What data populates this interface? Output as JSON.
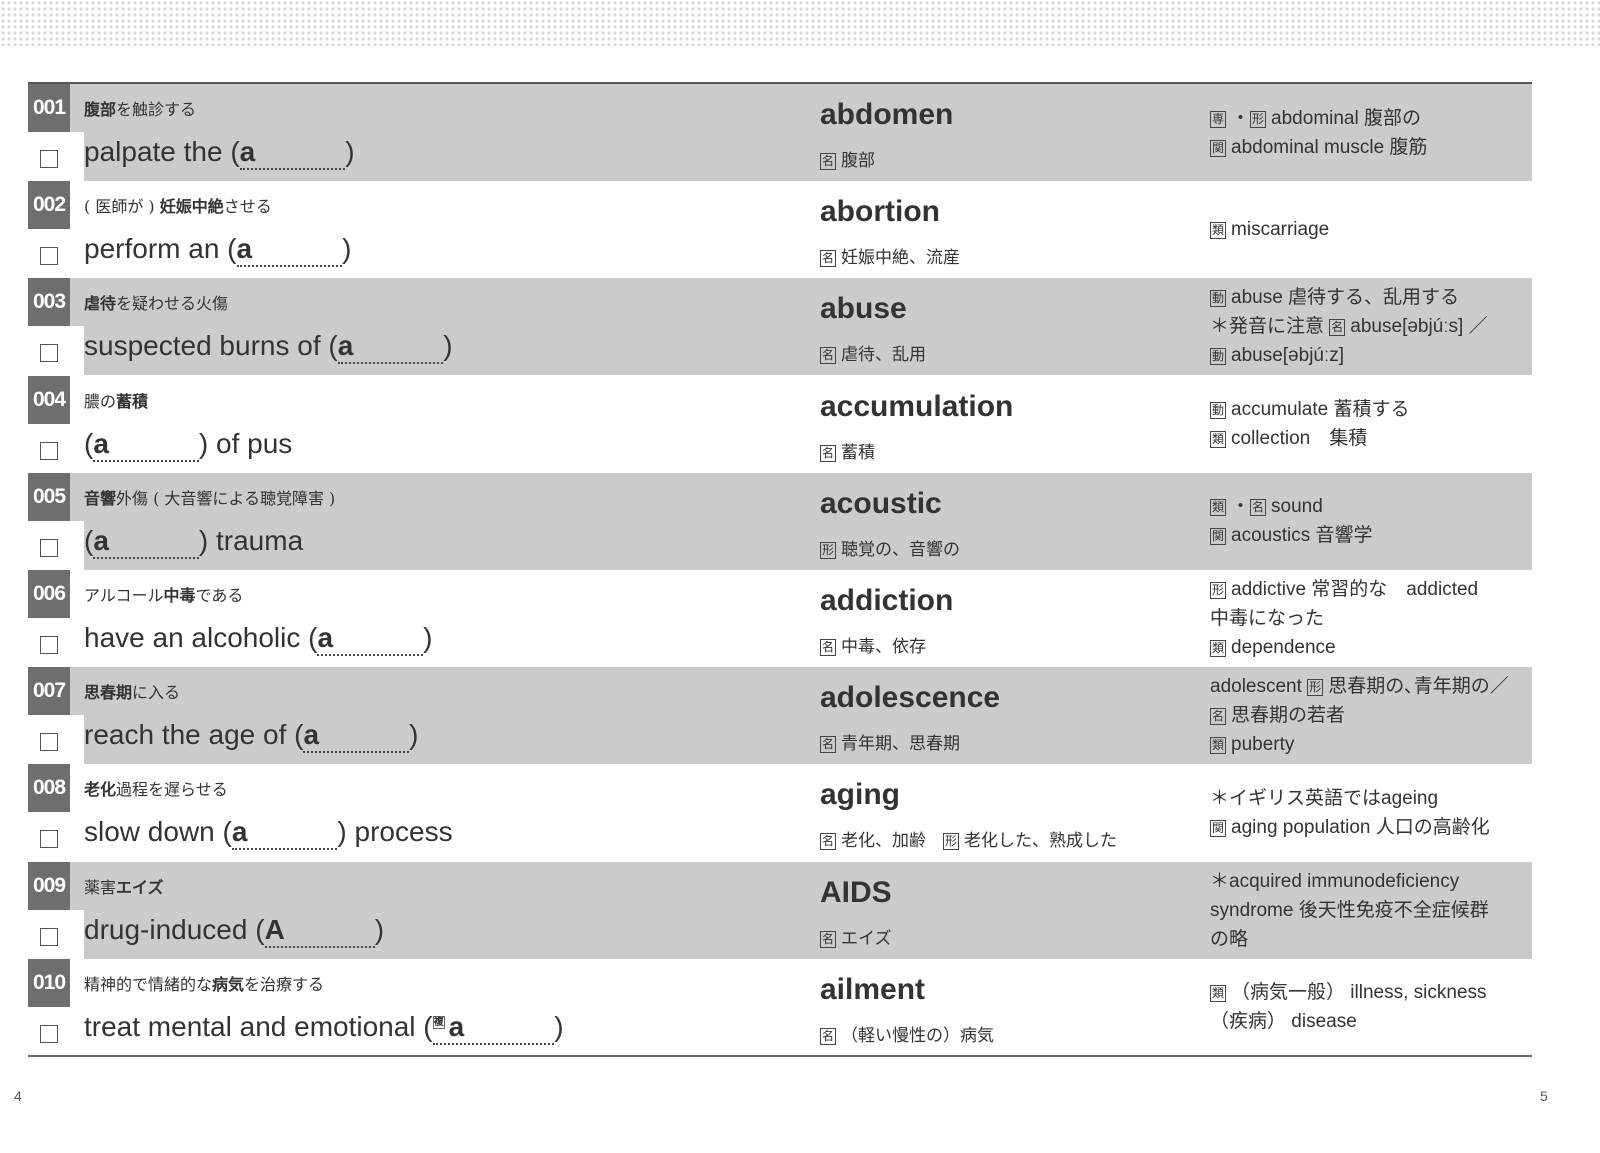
{
  "page_numbers": {
    "left": "4",
    "right": "5"
  },
  "colors": {
    "shade": "#c9cbcd",
    "number_box": "#6e6e6e"
  },
  "left_items": [
    {
      "num": "001",
      "jp": [
        {
          "t": "腹部",
          "b": true
        },
        {
          "t": "を触診する"
        }
      ],
      "before": "palpate the (",
      "hint": "a",
      "after": ")"
    },
    {
      "num": "002",
      "jp": [
        {
          "t": "( 医師が ) "
        },
        {
          "t": "妊娠中絶",
          "b": true
        },
        {
          "t": "させる"
        }
      ],
      "before": "perform an (",
      "hint": "a",
      "after": ")"
    },
    {
      "num": "003",
      "jp": [
        {
          "t": "虐待",
          "b": true
        },
        {
          "t": "を疑わせる火傷"
        }
      ],
      "before": "suspected burns of (",
      "hint": "a",
      "after": ")"
    },
    {
      "num": "004",
      "jp": [
        {
          "t": "膿の"
        },
        {
          "t": "蓄積",
          "b": true
        }
      ],
      "before": "(",
      "hint": "a",
      "after": ") of pus"
    },
    {
      "num": "005",
      "jp": [
        {
          "t": "音響",
          "b": true
        },
        {
          "t": "外傷 ( 大音響による聴覚障害 )"
        }
      ],
      "before": "(",
      "hint": "a",
      "after": ") trauma"
    },
    {
      "num": "006",
      "jp": [
        {
          "t": "アルコール"
        },
        {
          "t": "中毒",
          "b": true
        },
        {
          "t": "である"
        }
      ],
      "before": "have an alcoholic (",
      "hint": "a",
      "after": ")"
    },
    {
      "num": "007",
      "jp": [
        {
          "t": "思春期",
          "b": true
        },
        {
          "t": "に入る"
        }
      ],
      "before": "reach the age of (",
      "hint": "a",
      "after": ")"
    },
    {
      "num": "008",
      "jp": [
        {
          "t": "老化",
          "b": true
        },
        {
          "t": "過程を遅らせる"
        }
      ],
      "before": "slow down (",
      "hint": "a",
      "after": ") process"
    },
    {
      "num": "009",
      "jp": [
        {
          "t": "薬害"
        },
        {
          "t": "エイズ",
          "b": true
        }
      ],
      "before": "drug-induced (",
      "hint": "A",
      "after": ")"
    },
    {
      "num": "010",
      "jp": [
        {
          "t": "精神的で情緒的な"
        },
        {
          "t": "病気",
          "b": true
        },
        {
          "t": "を治療する"
        }
      ],
      "before": "treat mental and emotional (",
      "mark": "複",
      "hint": "a",
      "after": ")"
    }
  ],
  "right_items": [
    {
      "word": "abdomen",
      "pos": "名",
      "meaning": "腹部",
      "notes": [
        [
          {
            "box": "専"
          },
          {
            "t": "・"
          },
          {
            "box": "形"
          },
          {
            "t": "abdominal 腹部の"
          }
        ],
        [
          {
            "box": "関"
          },
          {
            "t": "abdominal muscle 腹筋"
          }
        ]
      ]
    },
    {
      "word": "abortion",
      "pos": "名",
      "meaning": "妊娠中絶、流産",
      "notes": [
        [
          {
            "box": "類"
          },
          {
            "t": "miscarriage"
          }
        ]
      ]
    },
    {
      "word": "abuse",
      "pos": "名",
      "meaning": "虐待、乱用",
      "notes": [
        [
          {
            "box": "動"
          },
          {
            "t": "abuse 虐待する、乱用する"
          }
        ],
        [
          {
            "t": "＊発音に注意 "
          },
          {
            "box": "名"
          },
          {
            "t": "abuse[əbjúːs] ／"
          }
        ],
        [
          {
            "box": "動"
          },
          {
            "t": "abuse[əbjúːz]"
          }
        ]
      ]
    },
    {
      "word": "accumulation",
      "pos": "名",
      "meaning": "蓄積",
      "notes": [
        [
          {
            "box": "動"
          },
          {
            "t": "accumulate 蓄積する"
          }
        ],
        [
          {
            "box": "類"
          },
          {
            "t": "collection　集積"
          }
        ]
      ]
    },
    {
      "word": "acoustic",
      "pos": "形",
      "meaning": "聴覚の、音響の",
      "notes": [
        [
          {
            "box": "類"
          },
          {
            "t": "・"
          },
          {
            "box": "名"
          },
          {
            "t": "sound"
          }
        ],
        [
          {
            "box": "関"
          },
          {
            "t": "acoustics 音響学"
          }
        ]
      ]
    },
    {
      "word": "addiction",
      "pos": "名",
      "meaning": "中毒、依存",
      "notes": [
        [
          {
            "box": "形"
          },
          {
            "t": "addictive 常習的な　addicted"
          }
        ],
        [
          {
            "t": "中毒になった"
          }
        ],
        [
          {
            "box": "類"
          },
          {
            "t": "dependence"
          }
        ]
      ]
    },
    {
      "word": "adolescence",
      "pos": "名",
      "meaning": "青年期、思春期",
      "notes": [
        [
          {
            "t": "adolescent "
          },
          {
            "box": "形"
          },
          {
            "t": "思春期の､青年期の／"
          }
        ],
        [
          {
            "box": "名"
          },
          {
            "t": "思春期の若者"
          }
        ],
        [
          {
            "box": "類"
          },
          {
            "t": "puberty"
          }
        ]
      ]
    },
    {
      "word": "aging",
      "pos": "名",
      "meaning": "老化、加齢　",
      "pos2": "形",
      "meaning2": "老化した、熟成した",
      "notes": [
        [
          {
            "t": "＊イギリス英語ではageing"
          }
        ],
        [
          {
            "box": "関"
          },
          {
            "t": "aging population 人口の高齢化"
          }
        ]
      ]
    },
    {
      "word": "AIDS",
      "pos": "名",
      "meaning": "エイズ",
      "notes": [
        [
          {
            "t": "＊acquired immunodeficiency"
          }
        ],
        [
          {
            "t": "syndrome 後天性免疫不全症候群"
          }
        ],
        [
          {
            "t": "の略"
          }
        ]
      ]
    },
    {
      "word": "ailment",
      "pos": "名",
      "meaning": "（軽い慢性の）病気",
      "notes": [
        [
          {
            "box": "類"
          },
          {
            "t": "（病気一般） illness,  sickness"
          }
        ],
        [
          {
            "t": "（疾病） disease"
          }
        ]
      ]
    }
  ]
}
